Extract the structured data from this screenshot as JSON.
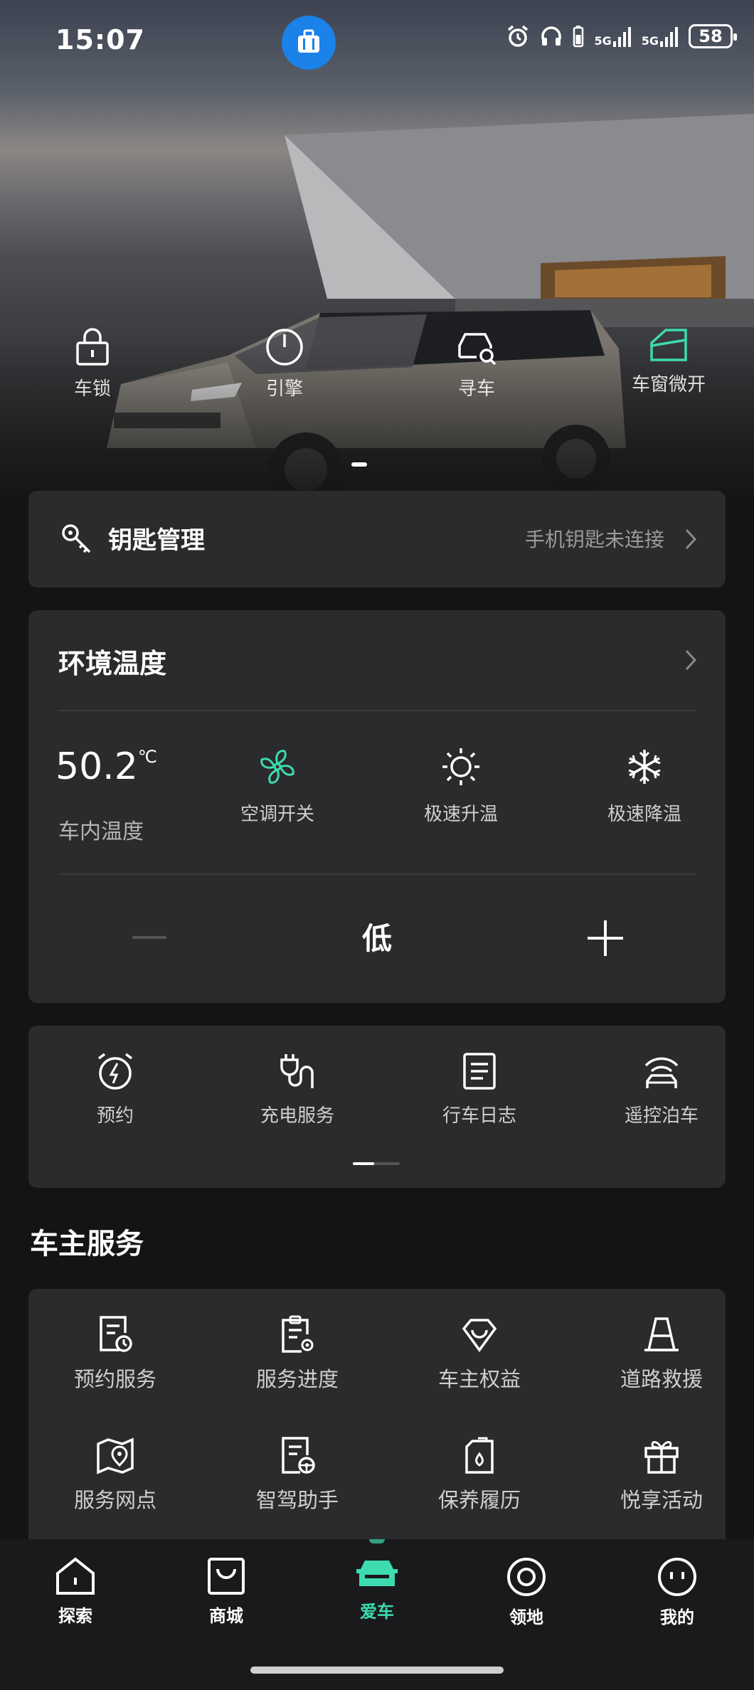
{
  "status_bar": {
    "time": "15:07",
    "network_1": "5G",
    "network_2": "5G",
    "battery": "58"
  },
  "quick_controls": [
    {
      "label": "车锁",
      "icon": "lock-icon"
    },
    {
      "label": "引擎",
      "icon": "power-icon"
    },
    {
      "label": "寻车",
      "icon": "find-car-icon"
    },
    {
      "label": "车窗微开",
      "icon": "window-icon"
    }
  ],
  "key_card": {
    "title": "钥匙管理",
    "status": "手机钥匙未连接"
  },
  "env_card": {
    "title": "环境温度",
    "temperature": "50.2",
    "temperature_unit": "℃",
    "temperature_label": "车内温度",
    "controls": [
      {
        "label": "空调开关",
        "icon": "fan-icon"
      },
      {
        "label": "极速升温",
        "icon": "sun-icon"
      },
      {
        "label": "极速降温",
        "icon": "snowflake-icon"
      }
    ],
    "fan_level": "低"
  },
  "functions": [
    {
      "label": "预约",
      "icon": "alarm-charge-icon"
    },
    {
      "label": "充电服务",
      "icon": "charging-plug-icon"
    },
    {
      "label": "行车日志",
      "icon": "log-document-icon"
    },
    {
      "label": "遥控泊车",
      "icon": "remote-parking-icon"
    }
  ],
  "services_section": {
    "title": "车主服务",
    "items": [
      {
        "label": "预约服务",
        "icon": "booking-document-icon"
      },
      {
        "label": "服务进度",
        "icon": "clipboard-progress-icon"
      },
      {
        "label": "车主权益",
        "icon": "diamond-benefit-icon"
      },
      {
        "label": "道路救援",
        "icon": "traffic-cone-icon"
      },
      {
        "label": "服务网点",
        "icon": "map-pin-icon"
      },
      {
        "label": "智驾助手",
        "icon": "steering-document-icon"
      },
      {
        "label": "保养履历",
        "icon": "oil-can-icon"
      },
      {
        "label": "悦享活动",
        "icon": "gift-icon"
      }
    ]
  },
  "bottom_nav": [
    {
      "label": "探索",
      "icon": "explore-home-icon"
    },
    {
      "label": "商城",
      "icon": "shop-bag-icon"
    },
    {
      "label": "爱车",
      "icon": "car-icon",
      "active": true
    },
    {
      "label": "领地",
      "icon": "territory-circle-icon"
    },
    {
      "label": "我的",
      "icon": "profile-face-icon"
    }
  ],
  "colors": {
    "accent": "#3ddbb0",
    "card": "#2b2b2d",
    "background": "#141414",
    "badge": "#1a82e8"
  }
}
